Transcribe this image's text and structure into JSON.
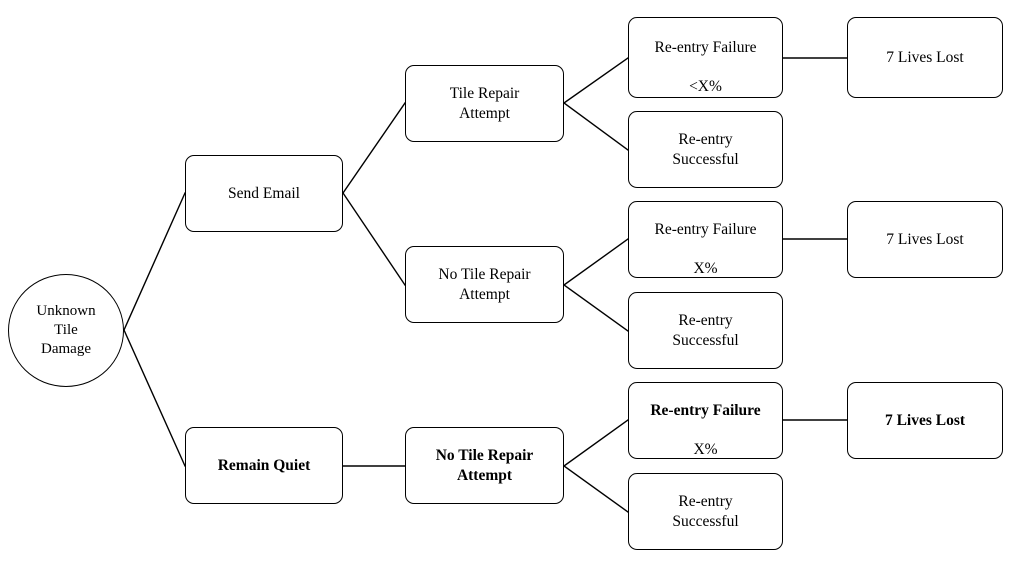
{
  "diagram": {
    "type": "decision-tree",
    "title": "Unknown Tile Damage decision tree",
    "stroke_color": "#000000",
    "background_color": "#ffffff",
    "nodes": {
      "root": {
        "label": "Unknown\nTile\nDamage",
        "bold": false,
        "shape": "ellipse"
      },
      "send_email": {
        "label": "Send Email",
        "bold": false,
        "shape": "rounded-rect"
      },
      "remain_quiet": {
        "label": "Remain Quiet",
        "bold": true,
        "shape": "rounded-rect"
      },
      "tile_repair_attempt": {
        "label": "Tile Repair\nAttempt",
        "bold": false,
        "shape": "rounded-rect"
      },
      "no_tile_repair_attempt_upper": {
        "label": "No Tile Repair\nAttempt",
        "bold": false,
        "shape": "rounded-rect"
      },
      "no_tile_repair_attempt_lower": {
        "label": "No Tile Repair\nAttempt",
        "bold": true,
        "shape": "rounded-rect"
      },
      "reentry_failure_lt_x": {
        "line1": "Re-entry Failure",
        "line2": "<X%",
        "bold": false,
        "shape": "rounded-rect"
      },
      "reentry_successful_1": {
        "label": "Re-entry\nSuccessful",
        "bold": false,
        "shape": "rounded-rect"
      },
      "reentry_failure_x_mid": {
        "line1": "Re-entry Failure",
        "line2": "X%",
        "bold": false,
        "shape": "rounded-rect"
      },
      "reentry_successful_2": {
        "label": "Re-entry\nSuccessful",
        "bold": false,
        "shape": "rounded-rect"
      },
      "reentry_failure_x_bottom": {
        "line1": "Re-entry Failure",
        "line2": "X%",
        "bold": true,
        "shape": "rounded-rect"
      },
      "reentry_successful_3": {
        "label": "Re-entry\nSuccessful",
        "bold": false,
        "shape": "rounded-rect"
      },
      "lives_lost_1": {
        "label": "7 Lives Lost",
        "bold": false,
        "shape": "rounded-rect"
      },
      "lives_lost_2": {
        "label": "7 Lives Lost",
        "bold": false,
        "shape": "rounded-rect"
      },
      "lives_lost_3": {
        "label": "7 Lives Lost",
        "bold": true,
        "shape": "rounded-rect"
      }
    },
    "edges": [
      {
        "from": "root",
        "to": "send_email"
      },
      {
        "from": "root",
        "to": "remain_quiet"
      },
      {
        "from": "send_email",
        "to": "tile_repair_attempt"
      },
      {
        "from": "send_email",
        "to": "no_tile_repair_attempt_upper"
      },
      {
        "from": "tile_repair_attempt",
        "to": "reentry_failure_lt_x"
      },
      {
        "from": "tile_repair_attempt",
        "to": "reentry_successful_1"
      },
      {
        "from": "no_tile_repair_attempt_upper",
        "to": "reentry_failure_x_mid"
      },
      {
        "from": "no_tile_repair_attempt_upper",
        "to": "reentry_successful_2"
      },
      {
        "from": "remain_quiet",
        "to": "no_tile_repair_attempt_lower"
      },
      {
        "from": "no_tile_repair_attempt_lower",
        "to": "reentry_failure_x_bottom"
      },
      {
        "from": "no_tile_repair_attempt_lower",
        "to": "reentry_successful_3"
      },
      {
        "from": "reentry_failure_lt_x",
        "to": "lives_lost_1"
      },
      {
        "from": "reentry_failure_x_mid",
        "to": "lives_lost_2"
      },
      {
        "from": "reentry_failure_x_bottom",
        "to": "lives_lost_3"
      }
    ]
  }
}
